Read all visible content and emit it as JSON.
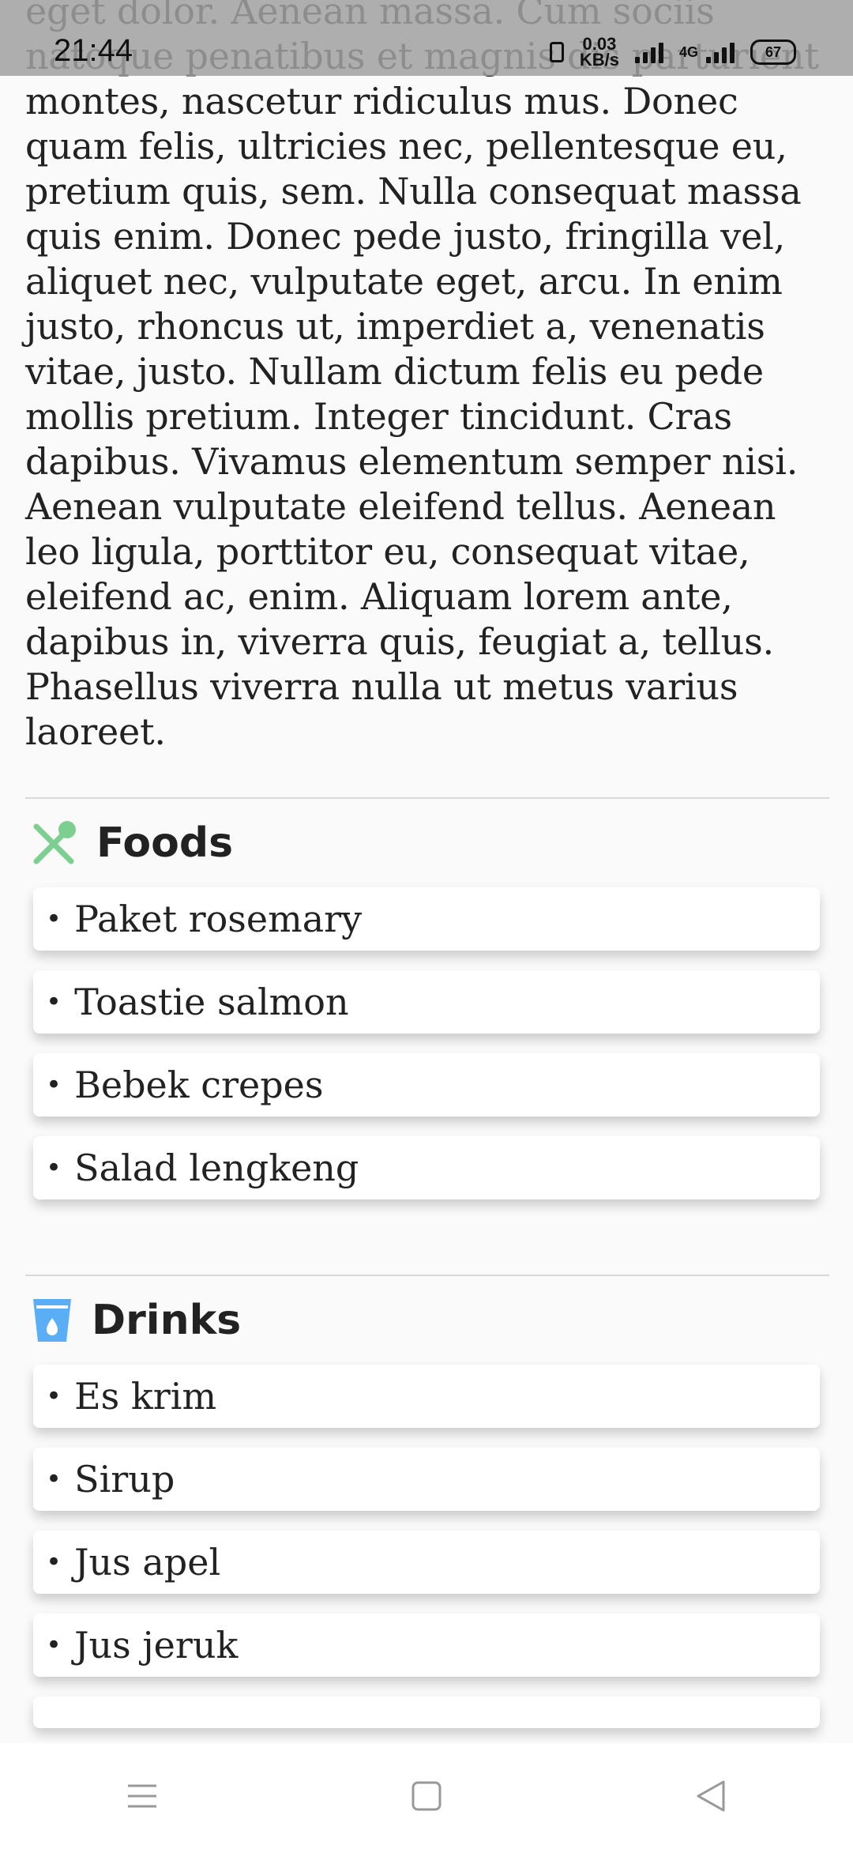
{
  "status_bar": {
    "time": "21:44",
    "net_speed_value": "0.03",
    "net_speed_unit": "KB/s",
    "network_type": "4G",
    "battery_level": "67"
  },
  "article": {
    "text": "eget dolor. Aenean massa. Cum sociis natoque penatibus et magnis dis parturient montes, nascetur ridiculus mus. Donec quam felis, ultricies nec, pellentesque eu, pretium quis, sem. Nulla consequat massa quis enim. Donec pede justo, fringilla vel, aliquet nec, vulputate eget, arcu. In enim justo, rhoncus ut, imperdiet a, venenatis vitae, justo. Nullam dictum felis eu pede mollis pretium. Integer tincidunt. Cras dapibus. Vivamus elementum semper nisi. Aenean vulputate eleifend tellus. Aenean leo ligula, porttitor eu, consequat vitae, eleifend ac, enim. Aliquam lorem ante, dapibus in, viverra quis, feugiat a, tellus. Phasellus viverra nulla ut metus varius laoreet."
  },
  "foods": {
    "title": "Foods",
    "icon": "utensils-icon",
    "icon_color": "#7ccf8e",
    "items": [
      "Paket rosemary",
      "Toastie salmon",
      "Bebek crepes",
      "Salad lengkeng"
    ]
  },
  "drinks": {
    "title": "Drinks",
    "icon": "glass-water-icon",
    "icon_color": "#5aaef5",
    "items": [
      "Es krim",
      "Sirup",
      "Jus apel",
      "Jus jeruk"
    ]
  },
  "bullet": "•"
}
